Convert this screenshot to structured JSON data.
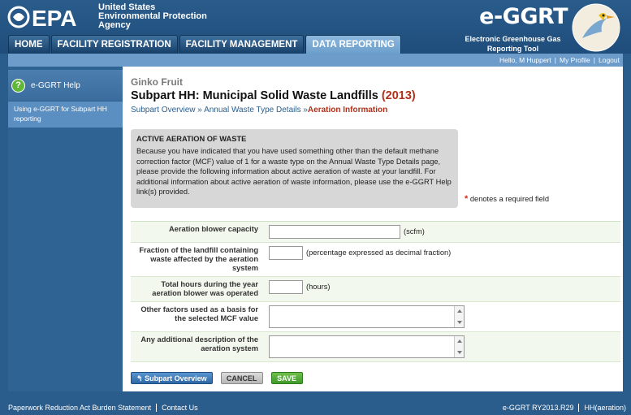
{
  "header": {
    "epa_logo_text": "EPA",
    "agency_lines": [
      "United States",
      "Environmental Protection",
      "Agency"
    ],
    "app_title": "e-GGRT",
    "app_subtitle_lines": [
      "Electronic Greenhouse Gas",
      "Reporting Tool"
    ],
    "tabs": [
      {
        "label": "HOME",
        "active": false
      },
      {
        "label": "FACILITY REGISTRATION",
        "active": false
      },
      {
        "label": "FACILITY MANAGEMENT",
        "active": false
      },
      {
        "label": "DATA REPORTING",
        "active": true
      }
    ]
  },
  "userbar": {
    "greeting": "Hello, M Huppert",
    "profile": "My Profile",
    "logout": "Logout"
  },
  "sidebar": {
    "help_label": "e-GGRT Help",
    "help_icon": "question-icon",
    "help_link": "Using e-GGRT for Subpart HH reporting"
  },
  "main": {
    "facility_name": "Ginko Fruit",
    "title": "Subpart HH: Municipal Solid Waste Landfills",
    "year": "(2013)",
    "breadcrumb": {
      "item1": "Subpart Overview",
      "sep": "»",
      "item2": "Annual Waste Type Details",
      "current": "Aeration Information"
    },
    "info": {
      "title": "ACTIVE AERATION OF WASTE",
      "text": "Because you have indicated that you have used something other than the default methane correction factor (MCF) value of 1 for a waste type on the Annual Waste Type Details page, please provide the following information about active aeration of waste at your landfill. For additional information about active aeration of waste information, please use the e-GGRT Help link(s) provided."
    },
    "required_note": "denotes a required field",
    "form": {
      "blower_capacity_label": "Aeration blower capacity",
      "blower_capacity_value": "",
      "blower_capacity_unit": "(scfm)",
      "fraction_label": "Fraction of the landfill containing waste affected by the aeration system",
      "fraction_value": "",
      "fraction_unit": "(percentage expressed as decimal fraction)",
      "hours_label": "Total hours during the year aeration blower was operated",
      "hours_value": "",
      "hours_unit": "(hours)",
      "other_factors_label": "Other factors used as a basis for the selected MCF value",
      "other_factors_value": "",
      "description_label": "Any additional description of the aeration system",
      "description_value": ""
    },
    "buttons": {
      "subpart_overview": "Subpart Overview",
      "cancel": "CANCEL",
      "save": "SAVE"
    }
  },
  "footer": {
    "paperwork": "Paperwork Reduction Act Burden Statement",
    "contact": "Contact Us",
    "version": "e-GGRT RY2013.R29",
    "page_id": "HH(aeration)"
  }
}
